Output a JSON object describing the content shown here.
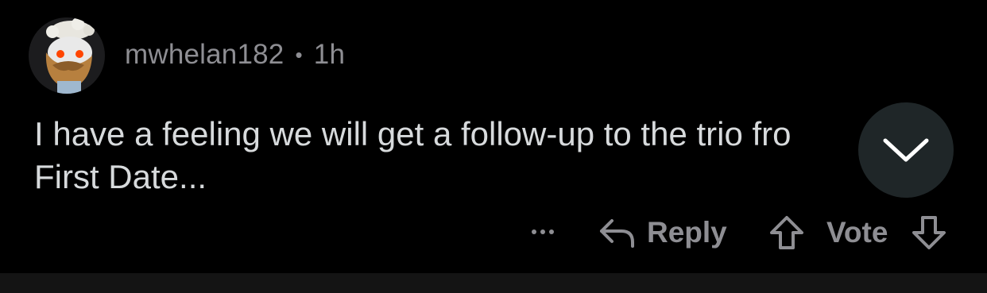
{
  "comment": {
    "author": "mwhelan182",
    "separator": "•",
    "time_ago": "1h",
    "body_line1": "I have a feeling we will get a follow-up to the trio fro",
    "body_line2": "First Date..."
  },
  "actions": {
    "more_label": "...",
    "reply_label": "Reply",
    "vote_label": "Vote"
  },
  "icons": {
    "avatar": "snoo-avatar-icon",
    "collapse": "chevron-down-icon",
    "reply": "reply-arrow-icon",
    "upvote": "upvote-arrow-icon",
    "downvote": "downvote-arrow-icon"
  },
  "colors": {
    "background": "#000000",
    "meta_text": "#8e8e93",
    "body_text": "#d7dadc",
    "collapse_button_bg": "#1f2628"
  }
}
